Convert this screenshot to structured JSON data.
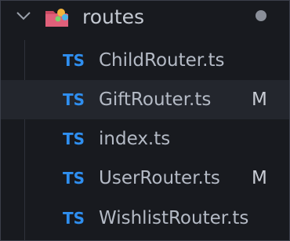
{
  "folder": {
    "name": "routes",
    "icon": "folder-routes-icon",
    "expanded": true,
    "has_changes_indicator": true
  },
  "files": [
    {
      "badge": "TS",
      "name": "ChildRouter.ts",
      "status": ""
    },
    {
      "badge": "TS",
      "name": "GiftRouter.ts",
      "status": "M",
      "selected": true
    },
    {
      "badge": "TS",
      "name": "index.ts",
      "status": ""
    },
    {
      "badge": "TS",
      "name": "UserRouter.ts",
      "status": "M"
    },
    {
      "badge": "TS",
      "name": "WishlistRouter.ts",
      "status": ""
    }
  ],
  "colors": {
    "background": "#181a1f",
    "ts_badge": "#2f8ff0",
    "selected_row": "#23262d",
    "text": "#b4bac5"
  }
}
